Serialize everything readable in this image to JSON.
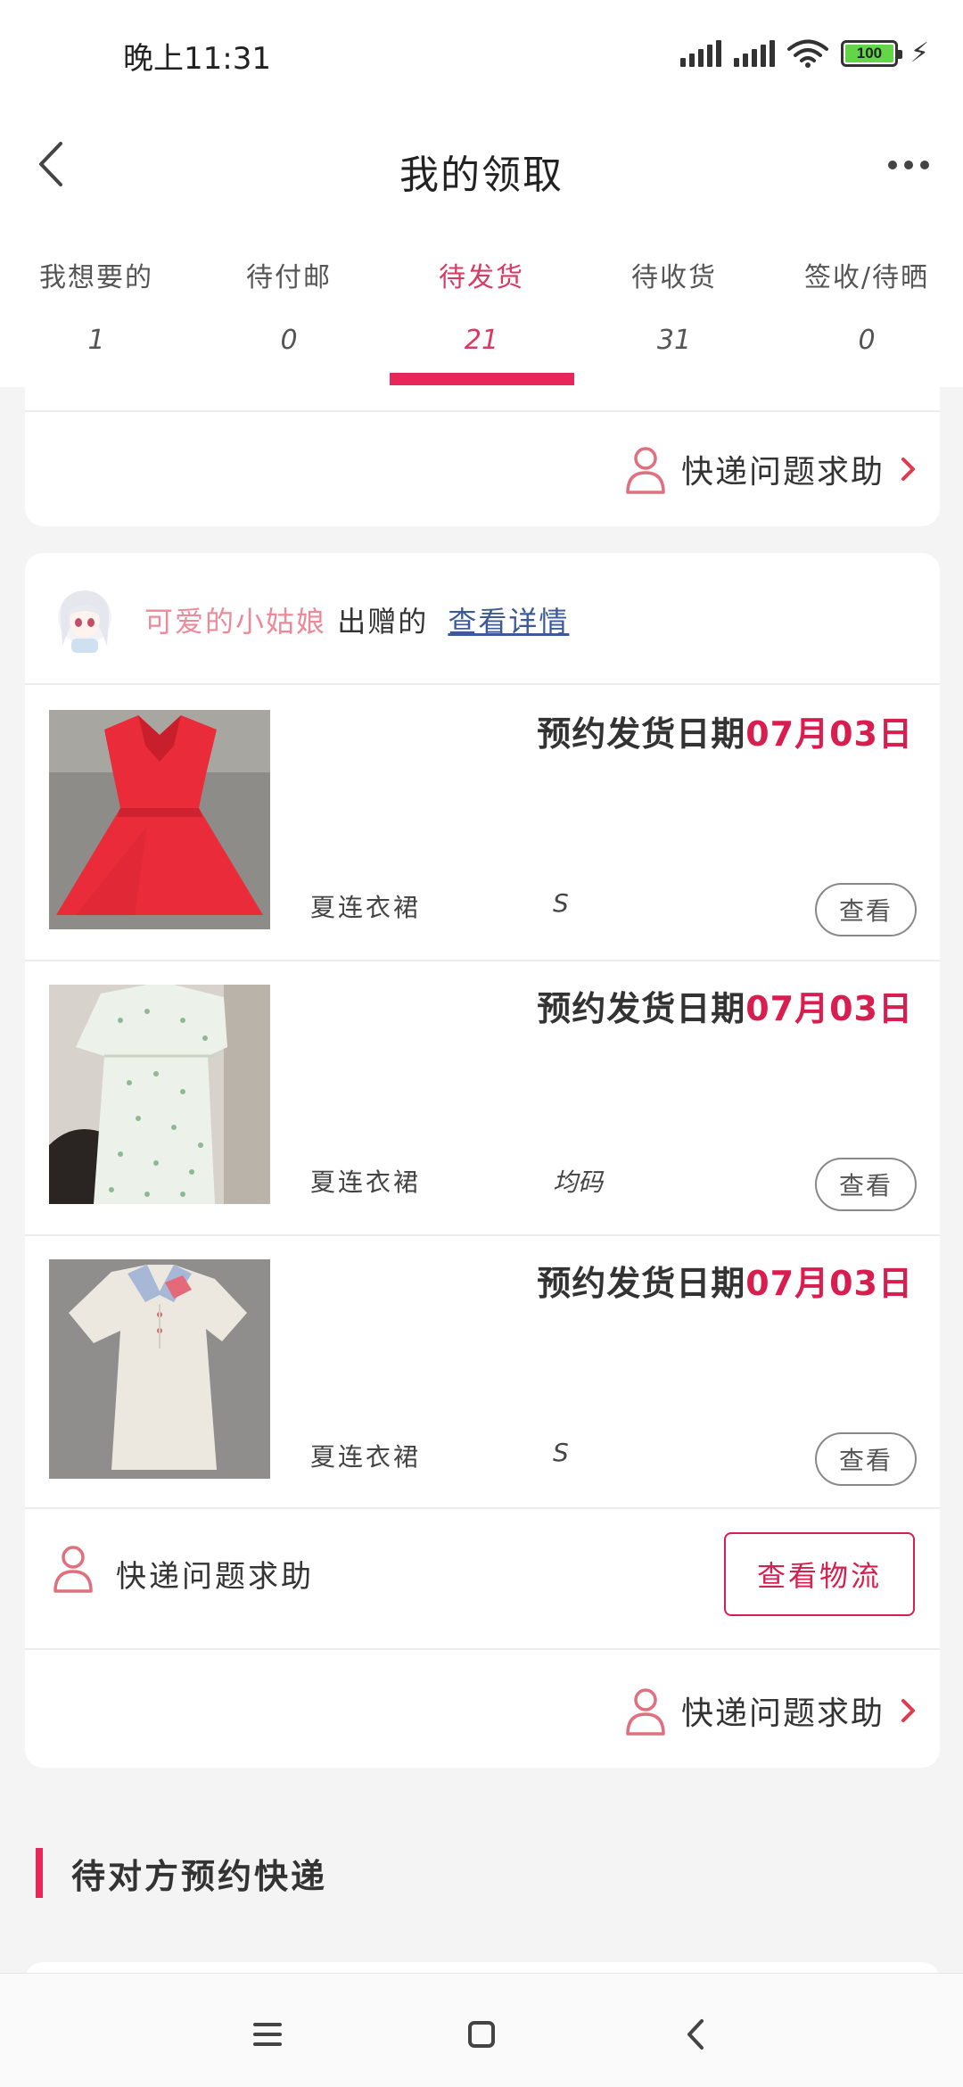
{
  "status_bar": {
    "time": "晚上11:31",
    "battery": "100"
  },
  "header": {
    "title": "我的领取"
  },
  "tabs": [
    {
      "label": "我想要的",
      "count": "1"
    },
    {
      "label": "待付邮",
      "count": "0"
    },
    {
      "label": "待发货",
      "count": "21",
      "active": true
    },
    {
      "label": "待收货",
      "count": "31"
    },
    {
      "label": "签收/待晒",
      "count": "0"
    }
  ],
  "top_card": {
    "help_label": "快递问题求助"
  },
  "order": {
    "donor_name": "可爱的小姑娘",
    "donor_suffix": "出赠的",
    "detail_link": "查看详情",
    "items": [
      {
        "ship_label": "预约发货日期",
        "ship_date": "07月03日",
        "name": "夏连衣裙",
        "size": "S",
        "view_label": "查看"
      },
      {
        "ship_label": "预约发货日期",
        "ship_date": "07月03日",
        "name": "夏连衣裙",
        "size": "均码",
        "view_label": "查看"
      },
      {
        "ship_label": "预约发货日期",
        "ship_date": "07月03日",
        "name": "夏连衣裙",
        "size": "S",
        "view_label": "查看"
      }
    ],
    "help_label": "快递问题求助",
    "logistics_label": "查看物流",
    "bottom_help_label": "快递问题求助"
  },
  "section": {
    "title": "待对方预约快递"
  },
  "colors": {
    "accent": "#e8265a",
    "date_red": "#d81e4f",
    "donor_pink": "#ec8a99",
    "link_blue": "#3c5a99"
  },
  "icons": [
    "back-arrow-icon",
    "more-dots-icon",
    "person-icon",
    "chevron-right-icon",
    "menu-icon",
    "home-icon",
    "nav-back-icon"
  ]
}
